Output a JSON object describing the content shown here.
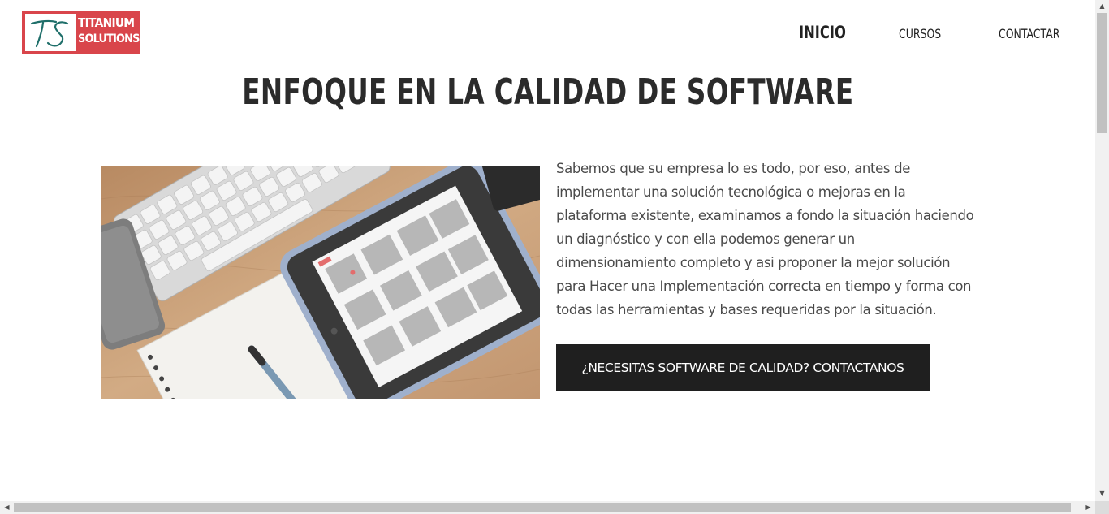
{
  "header": {
    "logo": {
      "monogram": "TS",
      "line1": "TITANIUM",
      "line2": "SOLUTIONS",
      "color": "#d9454b",
      "mark_color": "#1f6f6a"
    },
    "nav": [
      {
        "label": "INICIO",
        "active": true
      },
      {
        "label": "CURSOS",
        "active": false
      },
      {
        "label": "CONTACTAR",
        "active": false
      }
    ]
  },
  "main": {
    "title": "ENFOQUE EN LA CALIDAD DE SOFTWARE",
    "image": {
      "subject": "keyboard, tablet with calendar, notebook and pen on wooden desk"
    },
    "description_lines": [
      "Sabemos que su empresa lo es todo, por eso, antes de",
      "implementar una solución tecnológica o mejoras en la",
      "plataforma existente, examinamos a fondo la situación haciendo",
      "un diagnóstico y con ella podemos generar un",
      "dimensionamiento completo y asi proponer la mejor solución",
      "para Hacer una Implementación correcta en tiempo y forma con",
      "todas las herramientas y bases requeridas por la situación."
    ],
    "cta_label": "¿NECESITAS SOFTWARE DE CALIDAD? CONTACTANOS"
  },
  "scrollbars": {
    "vertical": {
      "up_icon": "triangle-up-icon",
      "down_icon": "triangle-down-icon",
      "up": "▲",
      "down": "▼"
    },
    "horizontal": {
      "left_icon": "triangle-left-icon",
      "right_icon": "triangle-right-icon",
      "left": "◀",
      "right": "▶"
    }
  },
  "colors": {
    "accent": "#d9454b",
    "cta_bg": "#1f1f1f",
    "text": "#4a4a4a"
  }
}
